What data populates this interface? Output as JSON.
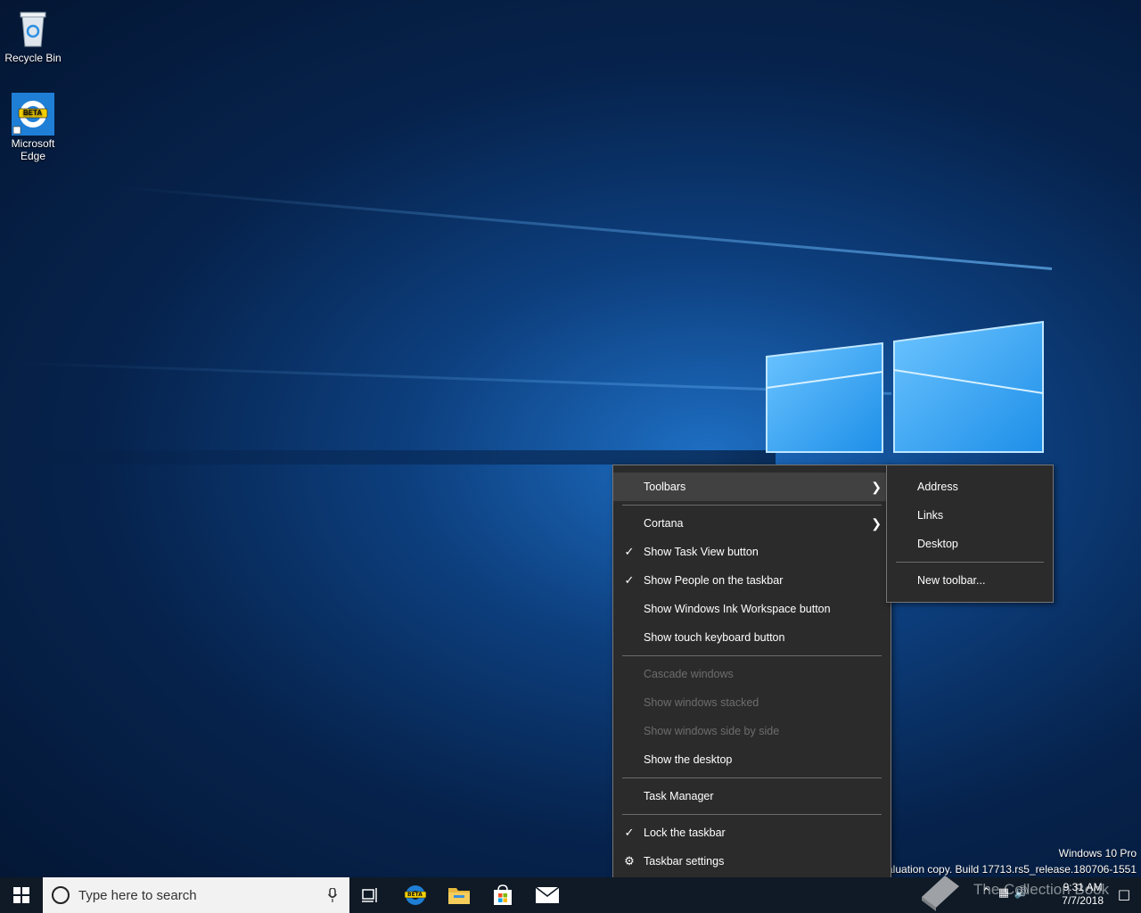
{
  "desktop": {
    "icons": [
      {
        "label": "Recycle Bin"
      },
      {
        "label": "Microsoft Edge",
        "badge": "BETA"
      }
    ],
    "watermark": {
      "edition": "Windows 10 Pro",
      "build": "Evaluation copy. Build 17713.rs5_release.180706-1551"
    }
  },
  "context_menu": {
    "items": [
      {
        "label": "Toolbars",
        "submenu": true,
        "highlighted": true
      },
      {
        "label": "Cortana",
        "submenu": true
      },
      {
        "label": "Show Task View button",
        "checked": true
      },
      {
        "label": "Show People on the taskbar",
        "checked": true
      },
      {
        "label": "Show Windows Ink Workspace button"
      },
      {
        "label": "Show touch keyboard button"
      },
      {
        "label": "Cascade windows",
        "disabled": true
      },
      {
        "label": "Show windows stacked",
        "disabled": true
      },
      {
        "label": "Show windows side by side",
        "disabled": true
      },
      {
        "label": "Show the desktop"
      },
      {
        "label": "Task Manager"
      },
      {
        "label": "Lock the taskbar",
        "checked": true
      },
      {
        "label": "Taskbar settings",
        "icon": "gear-icon"
      }
    ]
  },
  "toolbars_submenu": {
    "items": [
      {
        "label": "Address"
      },
      {
        "label": "Links"
      },
      {
        "label": "Desktop"
      },
      {
        "label": "New toolbar..."
      }
    ]
  },
  "taskbar": {
    "search_placeholder": "Type here to search",
    "edge_badge": "BETA",
    "clock_time": "9:31 AM",
    "clock_date": "7/7/2018",
    "overlay_brand": "The Collection Book"
  },
  "colors": {
    "menu_bg": "#2b2b2b",
    "menu_highlight": "#414141",
    "taskbar_bg": "#0f1a26"
  }
}
